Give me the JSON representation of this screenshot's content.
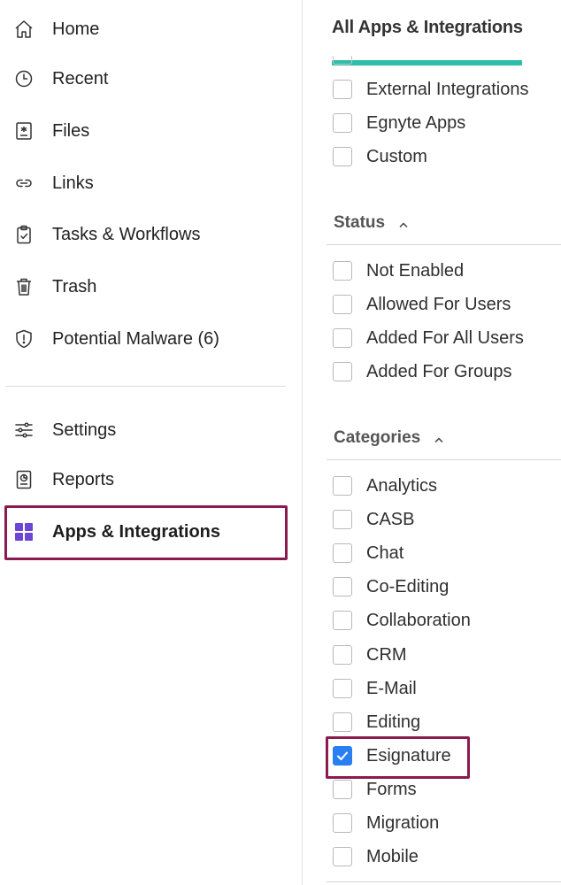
{
  "sidebar": {
    "items": [
      {
        "label": "Home",
        "icon": "home-icon"
      },
      {
        "label": "Recent",
        "icon": "clock-icon"
      },
      {
        "label": "Files",
        "icon": "files-icon"
      },
      {
        "label": "Links",
        "icon": "link-icon"
      },
      {
        "label": "Tasks & Workflows",
        "icon": "clipboard-check-icon"
      },
      {
        "label": "Trash",
        "icon": "trash-icon"
      },
      {
        "label": "Potential Malware (6)",
        "icon": "shield-alert-icon"
      }
    ],
    "admin_items": [
      {
        "label": "Settings",
        "icon": "sliders-icon"
      },
      {
        "label": "Reports",
        "icon": "report-icon"
      },
      {
        "label": "Apps & Integrations",
        "icon": "apps-grid-icon",
        "active": true
      }
    ]
  },
  "filters": {
    "tab_label": "All Apps & Integrations",
    "type_options": [
      {
        "label": "External Integrations",
        "checked": false
      },
      {
        "label": "Egnyte Apps",
        "checked": false
      },
      {
        "label": "Custom",
        "checked": false
      }
    ],
    "status": {
      "heading": "Status",
      "options": [
        {
          "label": "Not Enabled",
          "checked": false
        },
        {
          "label": "Allowed For Users",
          "checked": false
        },
        {
          "label": "Added For All Users",
          "checked": false
        },
        {
          "label": "Added For Groups",
          "checked": false
        }
      ]
    },
    "categories": {
      "heading": "Categories",
      "options": [
        {
          "label": "Analytics",
          "checked": false
        },
        {
          "label": "CASB",
          "checked": false
        },
        {
          "label": "Chat",
          "checked": false
        },
        {
          "label": "Co-Editing",
          "checked": false
        },
        {
          "label": "Collaboration",
          "checked": false
        },
        {
          "label": "CRM",
          "checked": false
        },
        {
          "label": "E-Mail",
          "checked": false
        },
        {
          "label": "Editing",
          "checked": false
        },
        {
          "label": "Esignature",
          "checked": true
        },
        {
          "label": "Forms",
          "checked": false
        },
        {
          "label": "Migration",
          "checked": false
        },
        {
          "label": "Mobile",
          "checked": false
        }
      ]
    }
  },
  "colors": {
    "accent_teal": "#2dbda8",
    "highlight_border": "#8a1a4f",
    "checkbox_checked": "#2a7ff0",
    "apps_icon_purple": "#6b46d6"
  }
}
